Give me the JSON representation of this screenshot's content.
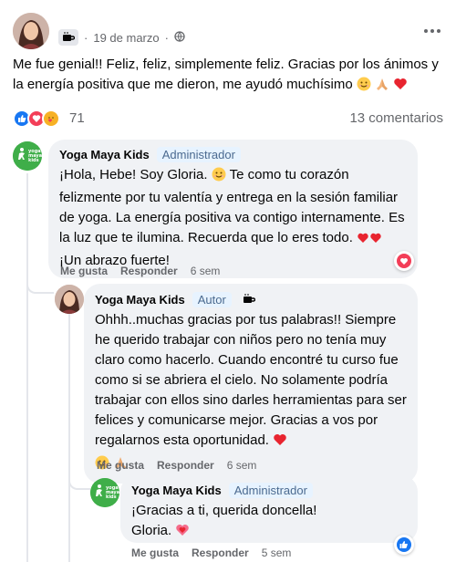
{
  "post": {
    "date": "19 de marzo",
    "separator": "·",
    "text": "Me fue genial!! Feliz, feliz, simplemente feliz. Gracias por los ánimos y la energía positiva que me dieron, me ayudó muchísimo",
    "reaction_count": "71",
    "comments_count": "13 comentarios"
  },
  "comments": [
    {
      "author": "Yoga Maya Kids",
      "badge": "Administrador",
      "text": "¡Hola, Hebe! Soy Gloria.",
      "text2": " Te como tu corazón felizmente por tu valentía y entrega en la sesión familiar de yoga. La energía positiva va contigo internamente. Es la luz que te ilumina. Recuerda que lo eres todo.",
      "text3": "¡Un abrazo fuerte!",
      "like": "Me gusta",
      "reply": "Responder",
      "time": "6 sem"
    },
    {
      "author": "Yoga Maya Kids",
      "badge": "Autor",
      "text": "Ohhh..muchas gracias por tus palabras!! Siempre he querido trabajar con niños pero no tenía muy claro como hacerlo. Cuando encontré tu curso fue como si se abriera el cielo. No solamente podría trabajar con ellos sino darles herramientas para ser felices y comunicarse mejor. Gracias a vos por regalarnos esta oportunidad.",
      "like": "Me gusta",
      "reply": "Responder",
      "time": "6 sem"
    },
    {
      "author": "Yoga Maya Kids",
      "badge": "Administrador",
      "text": "¡Gracias a ti, querida doncella!",
      "text2": "Gloria.",
      "like": "Me gusta",
      "reply": "Responder",
      "time": "5 sem"
    }
  ],
  "logo_text": [
    "yoga",
    "maya",
    "kids"
  ],
  "colors": {
    "admin_green": "#3fae49",
    "like_blue": "#1877f2",
    "love_red": "#f33e58",
    "bubble": "#f0f2f5",
    "muted": "#65676b"
  }
}
